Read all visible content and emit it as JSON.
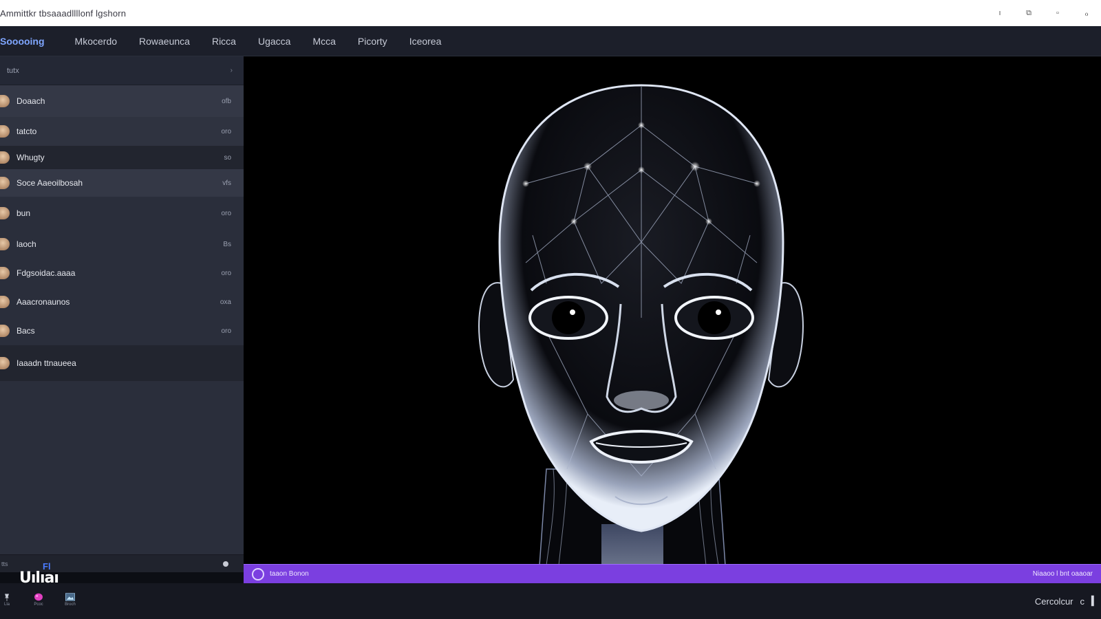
{
  "window": {
    "title": "Ammittkr tbsaaadllllonf lgshorn"
  },
  "menu": {
    "items": [
      "Sooooing",
      "Mkocerdo",
      "Rowaeunca",
      "Ricca",
      "Ugacca",
      "Mcca",
      "Picorty",
      "Iceorea"
    ]
  },
  "sidebar": {
    "header_label": "tutx",
    "items": [
      {
        "name": "Doaach",
        "meta": "ofb"
      },
      {
        "name": "tatcto",
        "meta": "oro"
      },
      {
        "name": "Whugty",
        "meta": "so"
      },
      {
        "name": "Soce Aaeoilbosah",
        "meta": "vfs"
      },
      {
        "name": "bun",
        "meta": "oro"
      },
      {
        "name": "laoch",
        "meta": "Bs"
      },
      {
        "name": "Fdgsoidac.aaaa",
        "meta": "oro"
      },
      {
        "name": "Aaacronaunos",
        "meta": "oxa"
      },
      {
        "name": "Bacs",
        "meta": "oro"
      },
      {
        "name": "Iaaadn ttnaueea",
        "meta": ""
      }
    ],
    "footer_label": "tts"
  },
  "status": {
    "left_text": "taaon Bonon",
    "right_text": "Niaaoo l bnt oaaoar"
  },
  "bottom": {
    "logo_text": "Uılıaı",
    "logo_sup": "Fl",
    "right_text": "Cercolcur",
    "right_icon": "c",
    "taskbar": [
      {
        "icon": "pin-icon",
        "label": "Lla"
      },
      {
        "icon": "paint-icon",
        "label": "Pcoc"
      },
      {
        "icon": "image-icon",
        "label": "Broch"
      }
    ]
  },
  "colors": {
    "accent": "#7b3fe0",
    "menu_active": "#7fa6ff",
    "sidebar": "#2a2e3b",
    "viewport": "#000000"
  }
}
